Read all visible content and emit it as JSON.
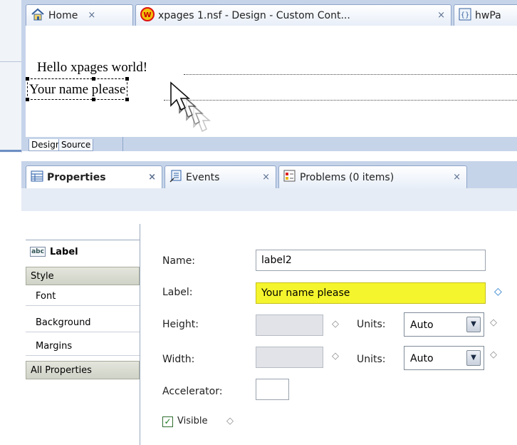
{
  "editor_tabs": [
    {
      "label": "Home",
      "close": "×",
      "icon": "home-icon"
    },
    {
      "label": "xpages 1.nsf - Design - Custom Cont...",
      "close": "×",
      "icon": "domino-db-icon"
    },
    {
      "label": "hwPa",
      "icon": "xpage-icon"
    }
  ],
  "canvas": {
    "hello_text": "Hello xpages world!",
    "name_label_text": "Your name please"
  },
  "editor_bottom_tabs": {
    "design": "Design",
    "source": "Source"
  },
  "view_tabs": [
    {
      "label": "Properties",
      "close": "×",
      "icon": "properties-icon"
    },
    {
      "label": "Events",
      "close": "×",
      "icon": "events-icon"
    },
    {
      "label": "Problems (0 items)",
      "close": "×",
      "icon": "problems-icon"
    }
  ],
  "nav": {
    "label_icon_text": "abc",
    "label": "Label",
    "style": "Style",
    "font": "Font",
    "background": "Background",
    "margins": "Margins",
    "all_properties": "All Properties"
  },
  "form": {
    "name_label": "Name:",
    "name_value": "label2",
    "label_label": "Label:",
    "label_value": "Your name please",
    "height_label": "Height:",
    "width_label": "Width:",
    "units_label": "Units:",
    "height_units": "Auto",
    "width_units": "Auto",
    "accelerator_label": "Accelerator:",
    "accelerator_value": "",
    "visible_label": "Visible",
    "visible_checked": true
  },
  "glyphs": {
    "diamond": "◇",
    "diamond_blue": "◇",
    "check": "✓",
    "dropdown": "▼"
  },
  "colors": {
    "highlight_field": "#f5f52d",
    "frame_blue": "#c6d4ea",
    "accent": "#1a73c9"
  }
}
